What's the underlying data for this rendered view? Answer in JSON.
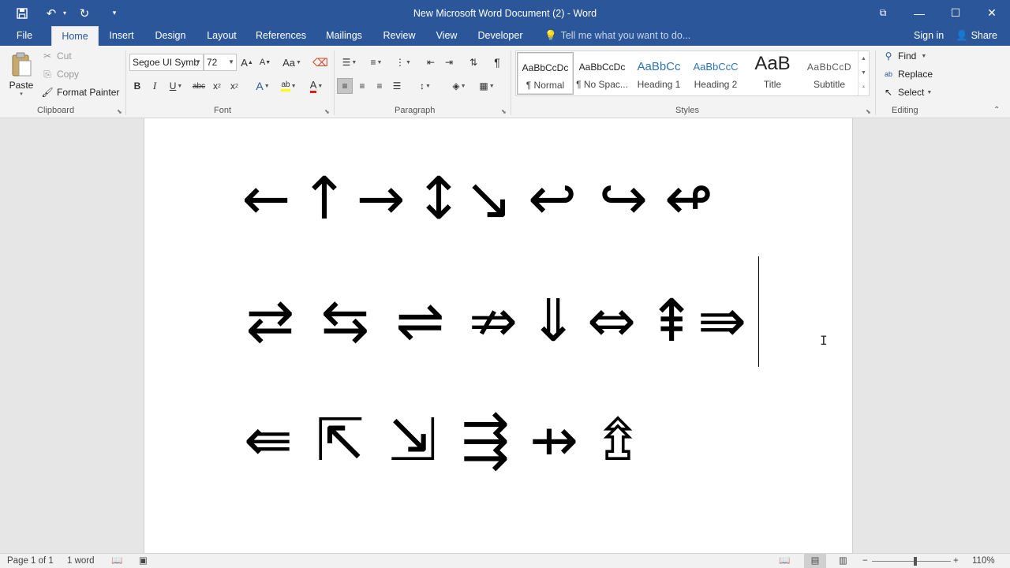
{
  "window": {
    "title": "New Microsoft Word Document (2) - Word"
  },
  "qat": {
    "save_icon": "save-icon",
    "undo_icon": "undo-icon",
    "redo_icon": "redo-icon",
    "customize_icon": "customize-qat-icon"
  },
  "tabs": [
    {
      "label": "File"
    },
    {
      "label": "Home"
    },
    {
      "label": "Insert"
    },
    {
      "label": "Design"
    },
    {
      "label": "Layout"
    },
    {
      "label": "References"
    },
    {
      "label": "Mailings"
    },
    {
      "label": "Review"
    },
    {
      "label": "View"
    },
    {
      "label": "Developer"
    }
  ],
  "tell_me": "Tell me what you want to do...",
  "sign_in": "Sign in",
  "share": "Share",
  "clipboard": {
    "label": "Clipboard",
    "paste": "Paste",
    "cut": "Cut",
    "copy": "Copy",
    "format_painter": "Format Painter"
  },
  "font": {
    "label": "Font",
    "family": "Segoe UI Symb",
    "size": "72",
    "grow": "A",
    "shrink": "A",
    "change_case": "Aa",
    "bold": "B",
    "italic": "I",
    "underline": "U",
    "strike": "abc",
    "subscript": "x",
    "superscript": "x",
    "effects": "A",
    "highlight": "ab",
    "color": "A"
  },
  "paragraph": {
    "label": "Paragraph"
  },
  "styles": {
    "label": "Styles",
    "items": [
      {
        "sample": "AaBbCcDc",
        "name": "¶ Normal"
      },
      {
        "sample": "AaBbCcDc",
        "name": "¶ No Spac..."
      },
      {
        "sample": "AaBbCc",
        "name": "Heading 1"
      },
      {
        "sample": "AaBbCcC",
        "name": "Heading 2"
      },
      {
        "sample": "AaB",
        "name": "Title"
      },
      {
        "sample": "AaBbCcD",
        "name": "Subtitle"
      }
    ]
  },
  "editing": {
    "label": "Editing",
    "find": "Find",
    "replace": "Replace",
    "select": "Select"
  },
  "document": {
    "rows": [
      [
        "←",
        "↑",
        "→",
        "↕",
        "↘",
        "↩",
        "↪",
        "↫"
      ],
      [
        "⇄",
        "⇆",
        "⇌",
        "⇏",
        "⇓",
        "⇔",
        "⇞",
        "⇛"
      ],
      [
        "⇚",
        "⇱",
        "⇲",
        "⇶",
        "⇸",
        "⇯"
      ]
    ]
  },
  "status": {
    "page": "Page 1 of 1",
    "words": "1 word",
    "zoom": "110%",
    "zoom_level": 0.55
  }
}
